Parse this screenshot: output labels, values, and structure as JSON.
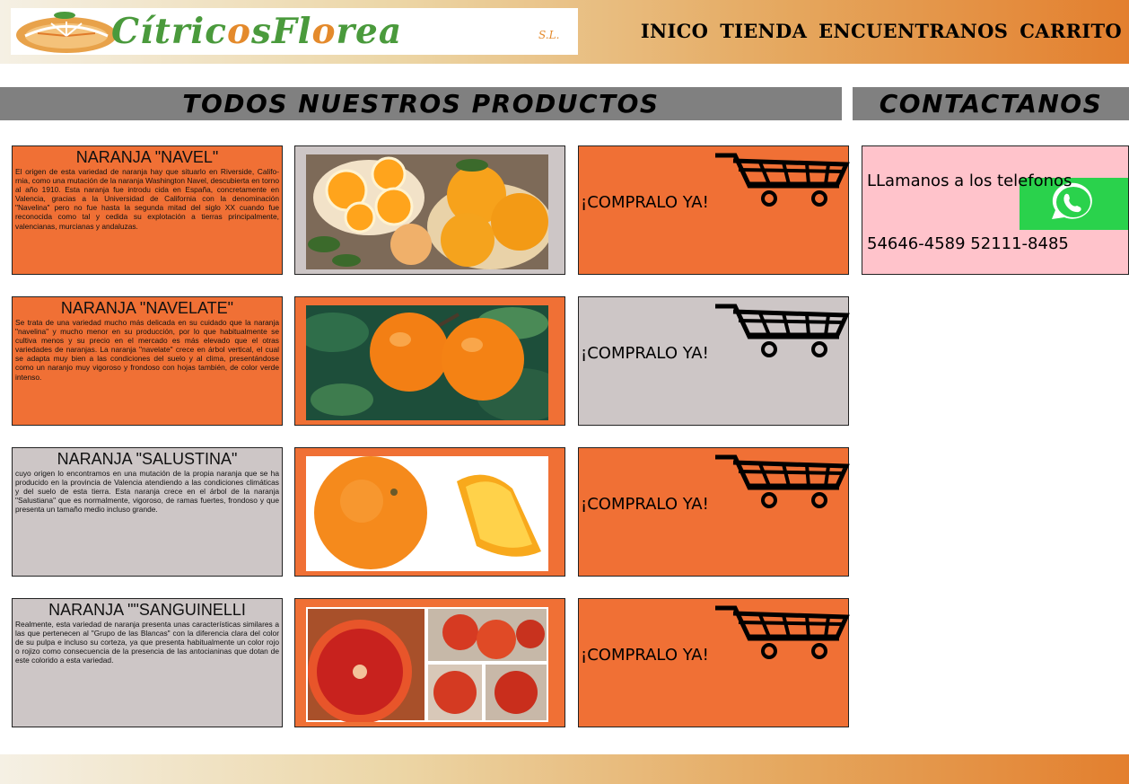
{
  "brand": {
    "name_start": "Cítric",
    "name_o1": "o",
    "name_mid": "sFl",
    "name_o2": "o",
    "name_end": "rea",
    "suffix": "S.L."
  },
  "nav": [
    "INICO",
    "TIENDA",
    "ENCUENTRANOS",
    "CARRITO"
  ],
  "sections": {
    "products": "TODOS NUESTROS PRODUCTOS",
    "contact": "CONTACTANOS"
  },
  "products": [
    {
      "title": "NARANJA \"NAVEL\"",
      "text": "El origen de esta variedad de naranja hay que situarlo en Riverside, Califo- rnia, como una mutación de la naranja Washington Navel, descubierta en torno al año 1910. Esta naranja fue introdu cida en España, concretamente en Valencia, gracias a la Universidad de California con la denominación \"Navelina\" pero no fue hasta la segunda mitad del siglo XX cuando fue reconocida como tal y cedida su explotación a tierras principalmente, valencianas, murcianas y andaluzas.",
      "buy": "¡COMPRALO YA!"
    },
    {
      "title": "NARANJA \"NAVELATE\"",
      "text": "Se trata de una variedad mucho más delicada en su cuidado que la naranja \"navelina\" y mucho menor en su producción, por lo que habitualmente se cultiva menos y su precio en el mercado es más elevado que el otras variedades de naranjas. La naranja \"navelate\" crece en árbol vertical, el cual se adapta muy bien a las condiciones del suelo y al clima, presentándose como un naranjo muy vigoroso y frondoso con hojas también, de color verde intenso.",
      "buy": "¡COMPRALO YA!"
    },
    {
      "title": "NARANJA \"SALUSTINA\"",
      "text": "cuyo origen lo encontramos en una mutación de la propia naranja que se ha producido en la provincia de Valencia atendiendo a las condiciones climáticas y del suelo de esta tierra. Esta naranja crece en el árbol de la naranja \"Salustiana\" que es normalmente, vigoroso, de ramas fuertes, frondoso y que presenta un tamaño medio incluso grande.",
      "buy": "¡COMPRALO YA!"
    },
    {
      "title": "NARANJA \"\"SANGUINELLI",
      "text": "Realmente, esta variedad de naranja presenta unas características similares a las que pertenecen al \"Grupo de las Blancas\" con la diferencia clara del color de su pulpa e incluso su corteza, ya que presenta habitualmente un color rojo o rojizo como consecuencia de la presencia de las antocianinas que dotan de este colorido a esta variedad.",
      "buy": "¡COMPRALO YA!"
    }
  ],
  "contact": {
    "text": "LLamanos a los telefonos 54646-4589 52111-8485"
  },
  "colors": {
    "orange": "#f07035",
    "grey": "#cdc6c6",
    "pink": "#ffc3cb",
    "whatsapp": "#2ad24c"
  }
}
